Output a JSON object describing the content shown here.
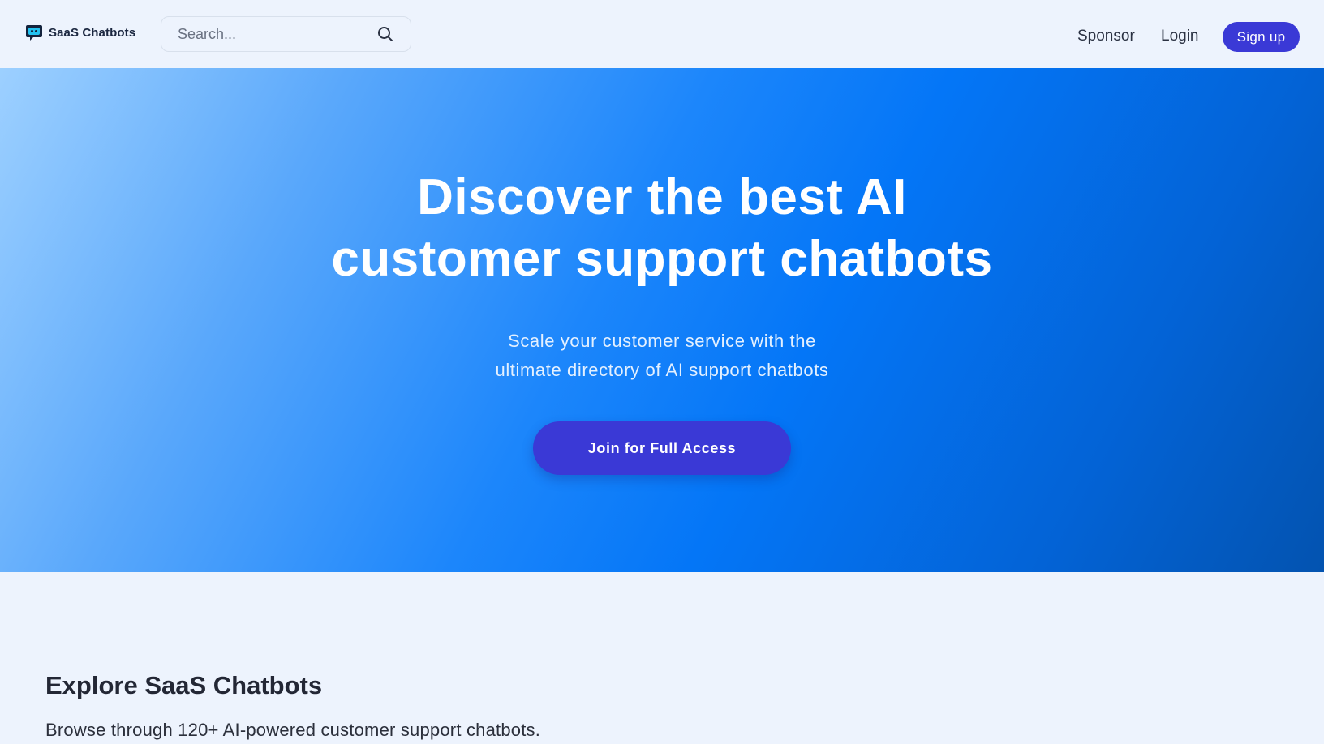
{
  "header": {
    "brand": "SaaS Chatbots",
    "logo_icon": "chatbot-bubble-icon",
    "search": {
      "placeholder": "Search...",
      "value": "",
      "icon": "search-icon"
    },
    "nav": {
      "sponsor": "Sponsor",
      "login": "Login",
      "signup": "Sign up"
    }
  },
  "hero": {
    "title_line1": "Discover the best AI",
    "title_line2": "customer support chatbots",
    "subtitle_line1": "Scale your customer service with the",
    "subtitle_line2": "ultimate directory of AI support chatbots",
    "cta": "Join for Full Access"
  },
  "explore": {
    "title": "Explore SaaS Chatbots",
    "description": "Browse through 120+ AI-powered customer support chatbots."
  },
  "colors": {
    "accent": "#3a39d6",
    "hero_gradient_start": "#9dd0ff",
    "hero_gradient_mid": "#0476f7",
    "hero_gradient_end": "#0353b0",
    "page_background": "#edf3fd"
  }
}
